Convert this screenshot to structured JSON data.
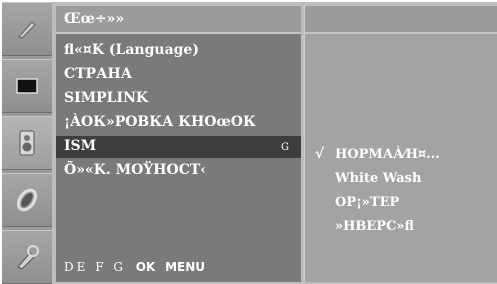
{
  "icons": [
    {
      "name": "picture-icon"
    },
    {
      "name": "screen-icon"
    },
    {
      "name": "speaker-icon"
    },
    {
      "name": "timer-icon"
    },
    {
      "name": "setup-icon"
    }
  ],
  "menu": {
    "title": "Œœ÷»»",
    "items": [
      {
        "label": "fl«¤K (Language)"
      },
      {
        "label": "СТРАНА"
      },
      {
        "label": "SIMPLINK"
      },
      {
        "label": "¡ÀОК»РОВКА КНОœОК"
      },
      {
        "label": "ISM",
        "selected": true,
        "key_hint": "G"
      },
      {
        "label": "Õ»«K. МОŸНОСТ‹"
      }
    ],
    "footer": {
      "symbols": "DE F G",
      "ok": "OK",
      "menu": "MENU"
    }
  },
  "submenu": {
    "check_mark": "√",
    "items": [
      {
        "label": "НОРМАÀ⁄Н¤...",
        "checked": true
      },
      {
        "label": "White Wash",
        "checked": false
      },
      {
        "label": "ОР¡»ТЕР",
        "checked": false
      },
      {
        "label": "»НВЕРС»fl",
        "checked": false
      }
    ]
  },
  "colors": {
    "menu_bg": "#7a7a7a",
    "selected_bg": "#3e3e3e",
    "submenu_bg": "#a3a3a3",
    "text": "#ffffff"
  }
}
